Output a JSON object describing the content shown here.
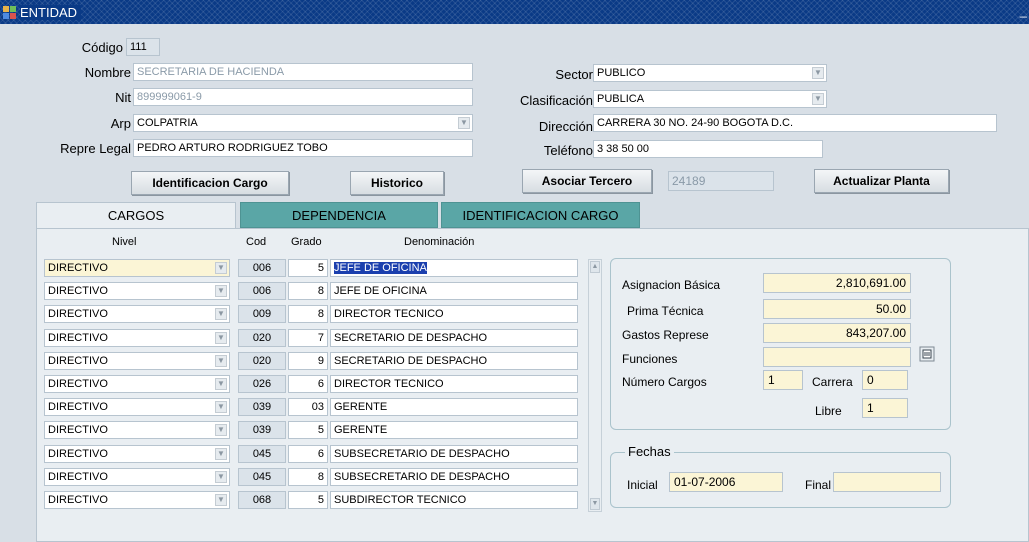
{
  "window": {
    "title": "ENTIDAD",
    "minimize": "_"
  },
  "header": {
    "codigo_label": "Código",
    "codigo": "111",
    "nombre_label": "Nombre",
    "nombre": "SECRETARIA DE HACIENDA",
    "nit_label": "Nit",
    "nit": "899999061-9",
    "arp_label": "Arp",
    "arp": "COLPATRIA",
    "repre_label": "Repre Legal",
    "repre": "PEDRO ARTURO RODRIGUEZ TOBO",
    "sector_label": "Sector",
    "sector": "PUBLICO",
    "clasif_label": "Clasificación",
    "clasif": "PUBLICA",
    "direccion_label": "Dirección",
    "direccion": "CARRERA 30 NO. 24-90 BOGOTA D.C.",
    "telefono_label": "Teléfono",
    "telefono": "3 38 50 00"
  },
  "buttons": {
    "identificacion_cargo": "Identificacion Cargo",
    "historico": "Historico",
    "asociar_tercero": "Asociar Tercero",
    "tercero_value": "24189",
    "actualizar_planta": "Actualizar Planta"
  },
  "tabs": [
    "CARGOS",
    "DEPENDENCIA",
    "IDENTIFICACION CARGO"
  ],
  "table": {
    "headers": {
      "nivel": "Nivel",
      "cod": "Cod",
      "grado": "Grado",
      "denominacion": "Denominación"
    },
    "rows": [
      {
        "nivel": "DIRECTIVO",
        "cod": "006",
        "grado": "5",
        "denominacion": "JEFE DE OFICINA"
      },
      {
        "nivel": "DIRECTIVO",
        "cod": "006",
        "grado": "8",
        "denominacion": "JEFE DE OFICINA"
      },
      {
        "nivel": "DIRECTIVO",
        "cod": "009",
        "grado": "8",
        "denominacion": "DIRECTOR TECNICO"
      },
      {
        "nivel": "DIRECTIVO",
        "cod": "020",
        "grado": "7",
        "denominacion": "SECRETARIO DE DESPACHO"
      },
      {
        "nivel": "DIRECTIVO",
        "cod": "020",
        "grado": "9",
        "denominacion": "SECRETARIO DE DESPACHO"
      },
      {
        "nivel": "DIRECTIVO",
        "cod": "026",
        "grado": "6",
        "denominacion": "DIRECTOR TECNICO"
      },
      {
        "nivel": "DIRECTIVO",
        "cod": "039",
        "grado": "03",
        "denominacion": "GERENTE"
      },
      {
        "nivel": "DIRECTIVO",
        "cod": "039",
        "grado": "5",
        "denominacion": "GERENTE"
      },
      {
        "nivel": "DIRECTIVO",
        "cod": "045",
        "grado": "6",
        "denominacion": "SUBSECRETARIO DE DESPACHO"
      },
      {
        "nivel": "DIRECTIVO",
        "cod": "045",
        "grado": "8",
        "denominacion": "SUBSECRETARIO DE DESPACHO"
      },
      {
        "nivel": "DIRECTIVO",
        "cod": "068",
        "grado": "5",
        "denominacion": "SUBDIRECTOR TECNICO"
      }
    ]
  },
  "details": {
    "asignacion_label": "Asignacion Básica",
    "asignacion": "2,810,691.00",
    "prima_label": "Prima Técnica",
    "prima": "50.00",
    "gastos_label": "Gastos Represe",
    "gastos": "843,207.00",
    "funciones_label": "Funciones",
    "funciones": "",
    "numero_label": "Número Cargos",
    "numero": "1",
    "carrera_label": "Carrera",
    "carrera": "0",
    "libre_label": "Libre",
    "libre": "1"
  },
  "fechas": {
    "title": "Fechas",
    "inicial_label": "Inicial",
    "inicial": "01-07-2006",
    "final_label": "Final",
    "final": ""
  },
  "colors": {
    "titlebar": "#0a3a86",
    "tab_inactive": "#5aa6a6",
    "highlight": "#1b3fae",
    "field_yellow": "#fbf5d6"
  }
}
